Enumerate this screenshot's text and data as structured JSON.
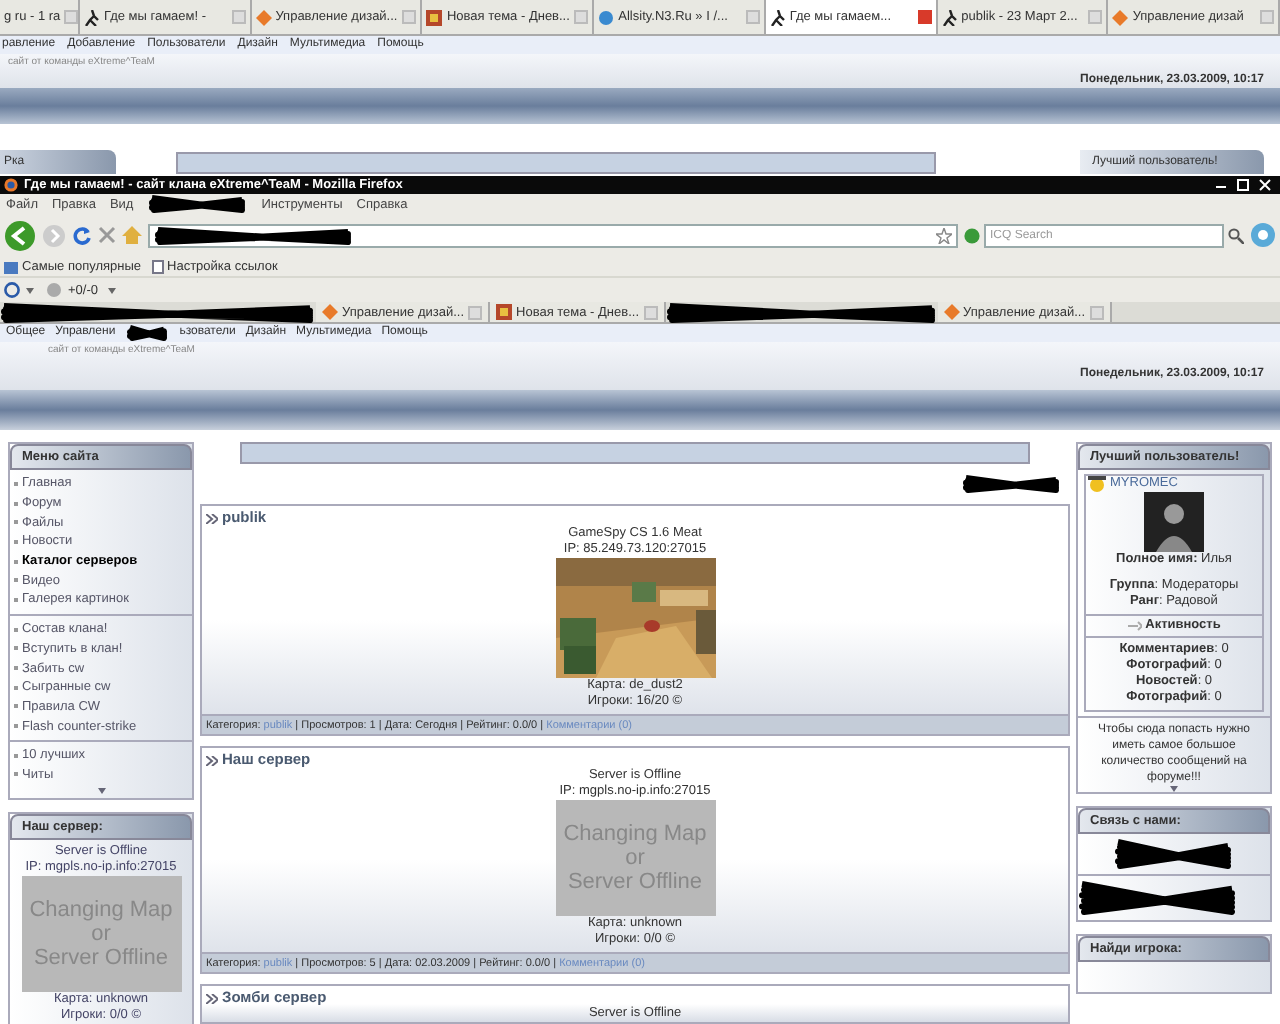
{
  "background_window": {
    "tabs": [
      {
        "label": "g ru - 1 ra",
        "selected": false
      },
      {
        "label": "Где мы гамаем! -",
        "selected": false
      },
      {
        "label": "Управление дизай...",
        "selected": false
      },
      {
        "label": "Новая тема - Днев...",
        "selected": false
      },
      {
        "label": "Allsity.N3.Ru » I /...",
        "selected": false
      },
      {
        "label": "Где мы гамаем...",
        "selected": true
      },
      {
        "label": "publik - 23 Март 2...",
        "selected": false
      },
      {
        "label": "Управление дизай",
        "selected": false
      }
    ],
    "menu": [
      "равление",
      "Добавление",
      "Пользователи",
      "Дизайн",
      "Мультимедиа",
      "Помощь"
    ],
    "subtitle": "сайт от команды eXtreme^TeaM",
    "date": "Понедельник, 23.03.2009, 10:17",
    "left_box_title": "Рка",
    "right_box_title": "Лучший пользователь!"
  },
  "window": {
    "title": "Где мы гамаем! - сайт клана eXtreme^TeaM - Mozilla Firefox",
    "menu": [
      "Файл",
      "Правка",
      "Вид",
      "Инструменты",
      "Справка"
    ],
    "search": {
      "placeholder": "ICQ Search"
    },
    "bookmarks": [
      "Самые популярные",
      "Настройка ссылок"
    ],
    "counter": "+0/-0",
    "tabs": [
      {
        "label": "Управление дизай..."
      },
      {
        "label": "Новая тема - Днев..."
      },
      {
        "label": "Управление дизай..."
      }
    ]
  },
  "page": {
    "menu": [
      "Общее",
      "Управлени",
      "ьзователи",
      "Дизайн",
      "Мультимедиа",
      "Помощь"
    ],
    "subtitle": "сайт от команды eXtreme^TeaM",
    "date": "Понедельник, 23.03.2009, 10:17",
    "site_menu": {
      "title": "Меню сайта",
      "groups": [
        [
          {
            "label": "Главная",
            "selected": false
          },
          {
            "label": "Форум",
            "selected": false
          },
          {
            "label": "Файлы",
            "selected": false
          },
          {
            "label": "Новости",
            "selected": false
          },
          {
            "label": "Каталог серверов",
            "selected": true
          },
          {
            "label": "Видео",
            "selected": false
          },
          {
            "label": "Галерея картинок",
            "selected": false
          }
        ],
        [
          {
            "label": "Состав клана!",
            "selected": false
          },
          {
            "label": "Вступить в клан!",
            "selected": false
          },
          {
            "label": "Забить cw",
            "selected": false
          },
          {
            "label": "Сыгранные cw",
            "selected": false
          },
          {
            "label": "Правила CW",
            "selected": false
          },
          {
            "label": "Flash counter-strike",
            "selected": false
          }
        ],
        [
          {
            "label": "10 лучших",
            "selected": false
          },
          {
            "label": "Читы",
            "selected": false
          }
        ]
      ]
    },
    "server_box": {
      "title": "Наш сервер:",
      "status": "Server is Offline",
      "ip": "IP: mgpls.no-ip.info:27015",
      "image": {
        "kind": "placeholder",
        "lines": [
          "Changing Map",
          "or",
          "Server Offline"
        ]
      },
      "map": "Карта: unknown",
      "players": "Игроки: 0/0 ©"
    },
    "entries": [
      {
        "title": "publik",
        "server": "GameSpy CS 1.6 Meat",
        "ip": "IP: 85.249.73.120:27015",
        "image": {
          "kind": "picture"
        },
        "map": "Карта: de_dust2",
        "players": "Игроки: 16/20 ©",
        "footer": [
          {
            "kind": "plain",
            "text": "Категория: "
          },
          {
            "kind": "link",
            "text": "publik"
          },
          {
            "kind": "plain",
            "text": " | Просмотров: 1 | Дата: Сегодня | Рейтинг: 0.0/0 | "
          },
          {
            "kind": "link",
            "text": "Комментарии (0)"
          }
        ]
      },
      {
        "title": "Наш сервер",
        "server": "Server is Offline",
        "ip": "IP: mgpls.no-ip.info:27015",
        "image": {
          "kind": "placeholder",
          "lines": [
            "Changing Map",
            "or",
            "Server Offline"
          ]
        },
        "map": "Карта: unknown",
        "players": "Игроки: 0/0 ©",
        "footer": [
          {
            "kind": "plain",
            "text": "Категория: "
          },
          {
            "kind": "link",
            "text": "publik"
          },
          {
            "kind": "plain",
            "text": " | Просмотров: 5 | Дата: 02.03.2009 | Рейтинг: 0.0/0 | "
          },
          {
            "kind": "link",
            "text": "Комментарии (0)"
          }
        ]
      },
      {
        "title": "Зомби сервер",
        "server": "Server is Offline"
      }
    ],
    "best_user": {
      "title": "Лучший пользователь!",
      "name": "MYROMEC",
      "details": [
        [
          "**Полное имя:** Илья"
        ],
        [
          "**Группа**: Модераторы",
          "**Ранг**: Радовой"
        ]
      ],
      "activity": "Активность",
      "stats": [
        "**Комментариев**: 0",
        "**Фотографий**: 0",
        "**Новостей**: 0",
        "**Фотографий**: 0"
      ],
      "note": "Чтобы сюда попасть нужно иметь самое большое количество сообщений на форуме!!!"
    },
    "contact_title": "Связь с нами:",
    "find_title": "Найди игрока:"
  }
}
